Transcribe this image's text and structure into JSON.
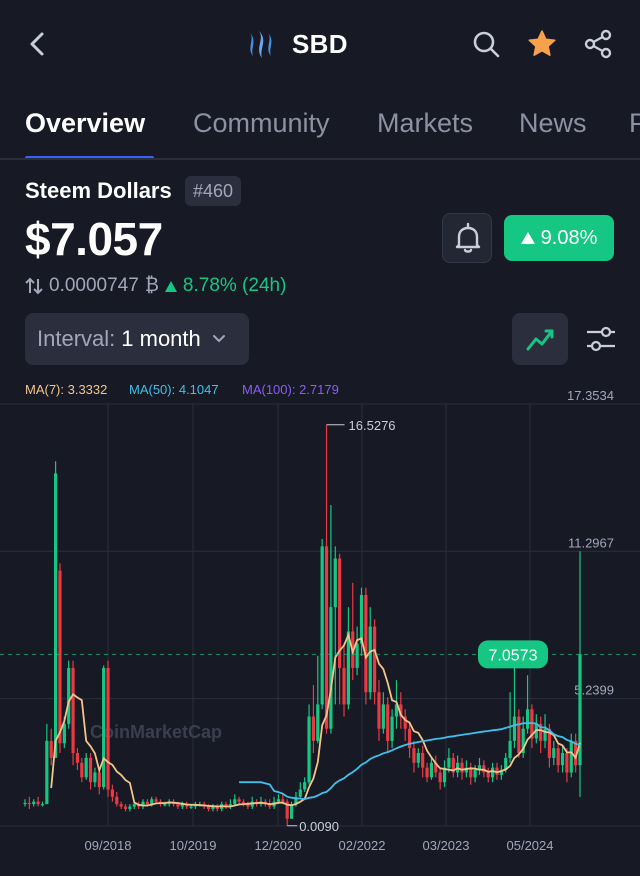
{
  "header": {
    "title": "SBD",
    "back_icon": "chevron-left-icon",
    "search_icon": "search-icon",
    "favorite_icon": "star-icon",
    "share_icon": "share-icon",
    "star_color": "#f7a24b"
  },
  "tabs": [
    {
      "label": "Overview",
      "active": true
    },
    {
      "label": "Community",
      "active": false
    },
    {
      "label": "Markets",
      "active": false
    },
    {
      "label": "News",
      "active": false
    },
    {
      "label": "P",
      "active": false
    }
  ],
  "coin": {
    "name": "Steem Dollars",
    "rank": "#460",
    "price": "$7.057",
    "change_24h": "9.08%",
    "btc_price": "0.0000747",
    "btc_symbol": "₿",
    "btc_change": "8.78% (24h)"
  },
  "controls": {
    "interval_label": "Interval:",
    "interval_value": "1 month"
  },
  "moving_averages": [
    {
      "label": "MA(7): 3.3332",
      "color": "#f3c58a"
    },
    {
      "label": "MA(50): 4.1047",
      "color": "#3fc1ea"
    },
    {
      "label": "MA(100): 2.7179",
      "color": "#8b5cf6"
    }
  ],
  "chart_data": {
    "type": "candlestick",
    "x_ticks": [
      "09/2018",
      "10/2019",
      "12/2020",
      "02/2022",
      "03/2023",
      "05/2024"
    ],
    "y_ticks": [
      "17.3534",
      "11.2967",
      "5.2399"
    ],
    "ylim": [
      0,
      17.3534
    ],
    "current_price_label": "7.0573",
    "current_price": 7.0573,
    "max_label": "16.5276",
    "max_value": 16.5276,
    "min_label": "0.0090",
    "min_value": 0.009,
    "watermark": "CoinMarketCap",
    "colors": {
      "up": "#16c784",
      "down": "#ea3943",
      "ma7": "#f3c58a",
      "ma50": "#3fc1ea",
      "ma100": "#8b5cf6"
    }
  }
}
